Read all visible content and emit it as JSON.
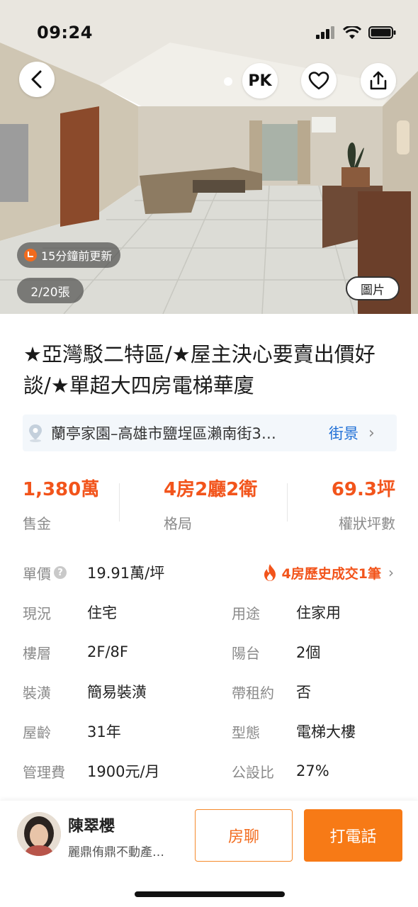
{
  "status_bar": {
    "time": "09:24"
  },
  "hero": {
    "pk_label": "PK",
    "updated": "15分鐘前更新",
    "photo_count": "2/20張",
    "photo_tab": "圖片"
  },
  "listing": {
    "title": "★亞灣駁二特區/★屋主決心要賣出價好談/★單超大四房電梯華廈",
    "address": "蘭亭家園–高雄市鹽埕區瀨南街3…",
    "street_view": "街景",
    "stats": [
      {
        "value": "1,380萬",
        "label": "售金"
      },
      {
        "value": "4房2廳2衛",
        "label": "格局"
      },
      {
        "value": "69.3坪",
        "label": "權狀坪數"
      }
    ],
    "unit_price": {
      "label": "單價",
      "value": "19.91萬/坪"
    },
    "history": "4房歷史成交1筆",
    "details": [
      {
        "k1": "現況",
        "v1": "住宅",
        "k2": "用途",
        "v2": "住家用"
      },
      {
        "k1": "樓層",
        "v1": "2F/8F",
        "k2": "陽台",
        "v2": "2個"
      },
      {
        "k1": "裝潢",
        "v1": "簡易裝潢",
        "k2": "帶租約",
        "v2": "否"
      },
      {
        "k1": "屋齡",
        "v1": "31年",
        "k2": "型態",
        "v2": "電梯大樓"
      },
      {
        "k1": "管理費",
        "v1": "1900元/月",
        "k2": "公設比",
        "v2": "27%"
      }
    ]
  },
  "agent": {
    "name": "陳翠櫻",
    "company": "麗鼎侑鼎不動產…",
    "chat_label": "房聊",
    "call_label": "打電話"
  },
  "colors": {
    "accent": "#f2541b",
    "call_button": "#f77a16",
    "link": "#1d6ed6"
  }
}
